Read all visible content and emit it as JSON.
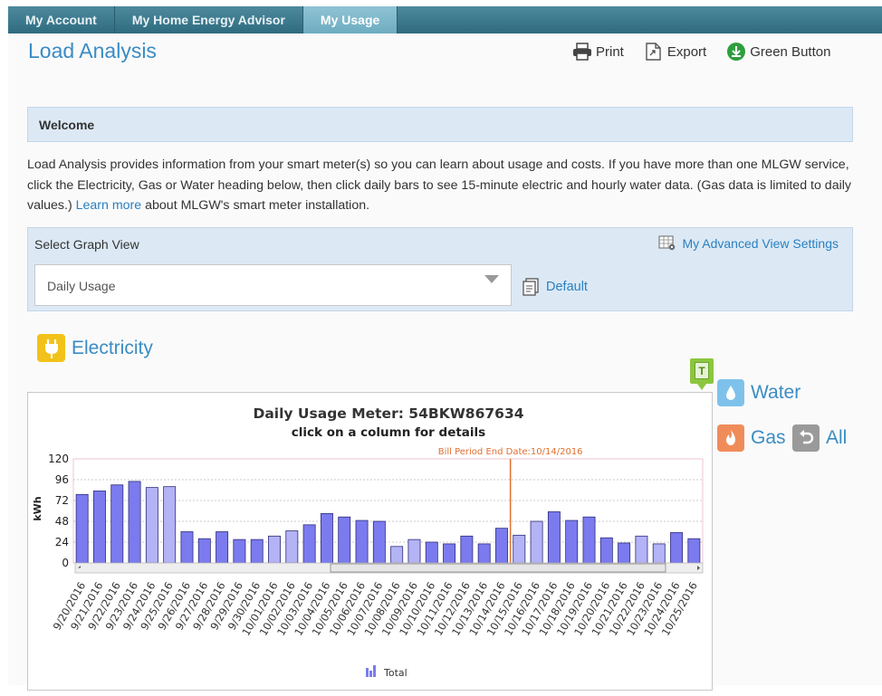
{
  "nav": {
    "tabs": [
      {
        "label": "My Account",
        "active": false
      },
      {
        "label": "My Home Energy Advisor",
        "active": false
      },
      {
        "label": "My Usage",
        "active": true
      }
    ]
  },
  "page": {
    "title": "Load Analysis"
  },
  "toolbar": {
    "print": "Print",
    "export": "Export",
    "green_button": "Green Button"
  },
  "welcome": {
    "title": "Welcome"
  },
  "intro": {
    "text_before": "Load Analysis provides information from your smart meter(s) so you can learn about usage and costs. If you have more than one MLGW service, click the Electricity, Gas or Water heading below, then click daily bars to see 15-minute electric and hourly water data. (Gas data is limited to daily values.) ",
    "link": "Learn more",
    "text_after": " about MLGW's smart meter installation."
  },
  "graph_view": {
    "label": "Select Graph View",
    "advanced": "My Advanced View Settings",
    "selected": "Daily Usage",
    "default_label": "Default"
  },
  "utilities": {
    "electricity": "Electricity",
    "water": "Water",
    "gas": "Gas",
    "all": "All",
    "badge": "T"
  },
  "colors": {
    "accent": "#3a8cc4",
    "bar_dark": "#7b7bef",
    "bar_light": "#b3b3f5",
    "marker": "#e07030",
    "electricity_icon": "#f2c21a",
    "water_icon": "#7ec2ec",
    "gas_icon": "#f08c5a",
    "all_icon": "#9a9a9a"
  },
  "chart_data": {
    "type": "bar",
    "title": "Daily Usage Meter: 54BKW867634",
    "subtitle": "click on a column for details",
    "ylabel": "kWh",
    "ylim": [
      0,
      120
    ],
    "yticks": [
      0,
      24,
      48,
      72,
      96,
      120
    ],
    "marker_label": "Bill Period End Date:10/14/2016",
    "marker_after_category": "10/14/2016",
    "legend": "Total",
    "grid": true,
    "categories": [
      "9/20/2016",
      "9/21/2016",
      "9/22/2016",
      "9/23/2016",
      "9/24/2016",
      "9/25/2016",
      "9/26/2016",
      "9/27/2016",
      "9/28/2016",
      "9/29/2016",
      "9/30/2016",
      "10/01/2016",
      "10/02/2016",
      "10/03/2016",
      "10/04/2016",
      "10/05/2016",
      "10/06/2016",
      "10/07/2016",
      "10/08/2016",
      "10/09/2016",
      "10/10/2016",
      "10/11/2016",
      "10/12/2016",
      "10/13/2016",
      "10/14/2016",
      "10/15/2016",
      "10/16/2016",
      "10/17/2016",
      "10/18/2016",
      "10/19/2016",
      "10/20/2016",
      "10/21/2016",
      "10/22/2016",
      "10/23/2016",
      "10/24/2016",
      "10/25/2016"
    ],
    "values": [
      79,
      83,
      90,
      94,
      87,
      88,
      36,
      28,
      36,
      27,
      27,
      31,
      37,
      44,
      57,
      53,
      49,
      48,
      19,
      27,
      24,
      22,
      31,
      22,
      40,
      32,
      48,
      59,
      49,
      53,
      29,
      23,
      31,
      22,
      35,
      28
    ],
    "weekend": [
      false,
      false,
      false,
      false,
      true,
      true,
      false,
      false,
      false,
      false,
      false,
      true,
      true,
      false,
      false,
      false,
      false,
      false,
      true,
      true,
      false,
      false,
      false,
      false,
      false,
      true,
      true,
      false,
      false,
      false,
      false,
      false,
      true,
      true,
      false,
      false
    ]
  }
}
